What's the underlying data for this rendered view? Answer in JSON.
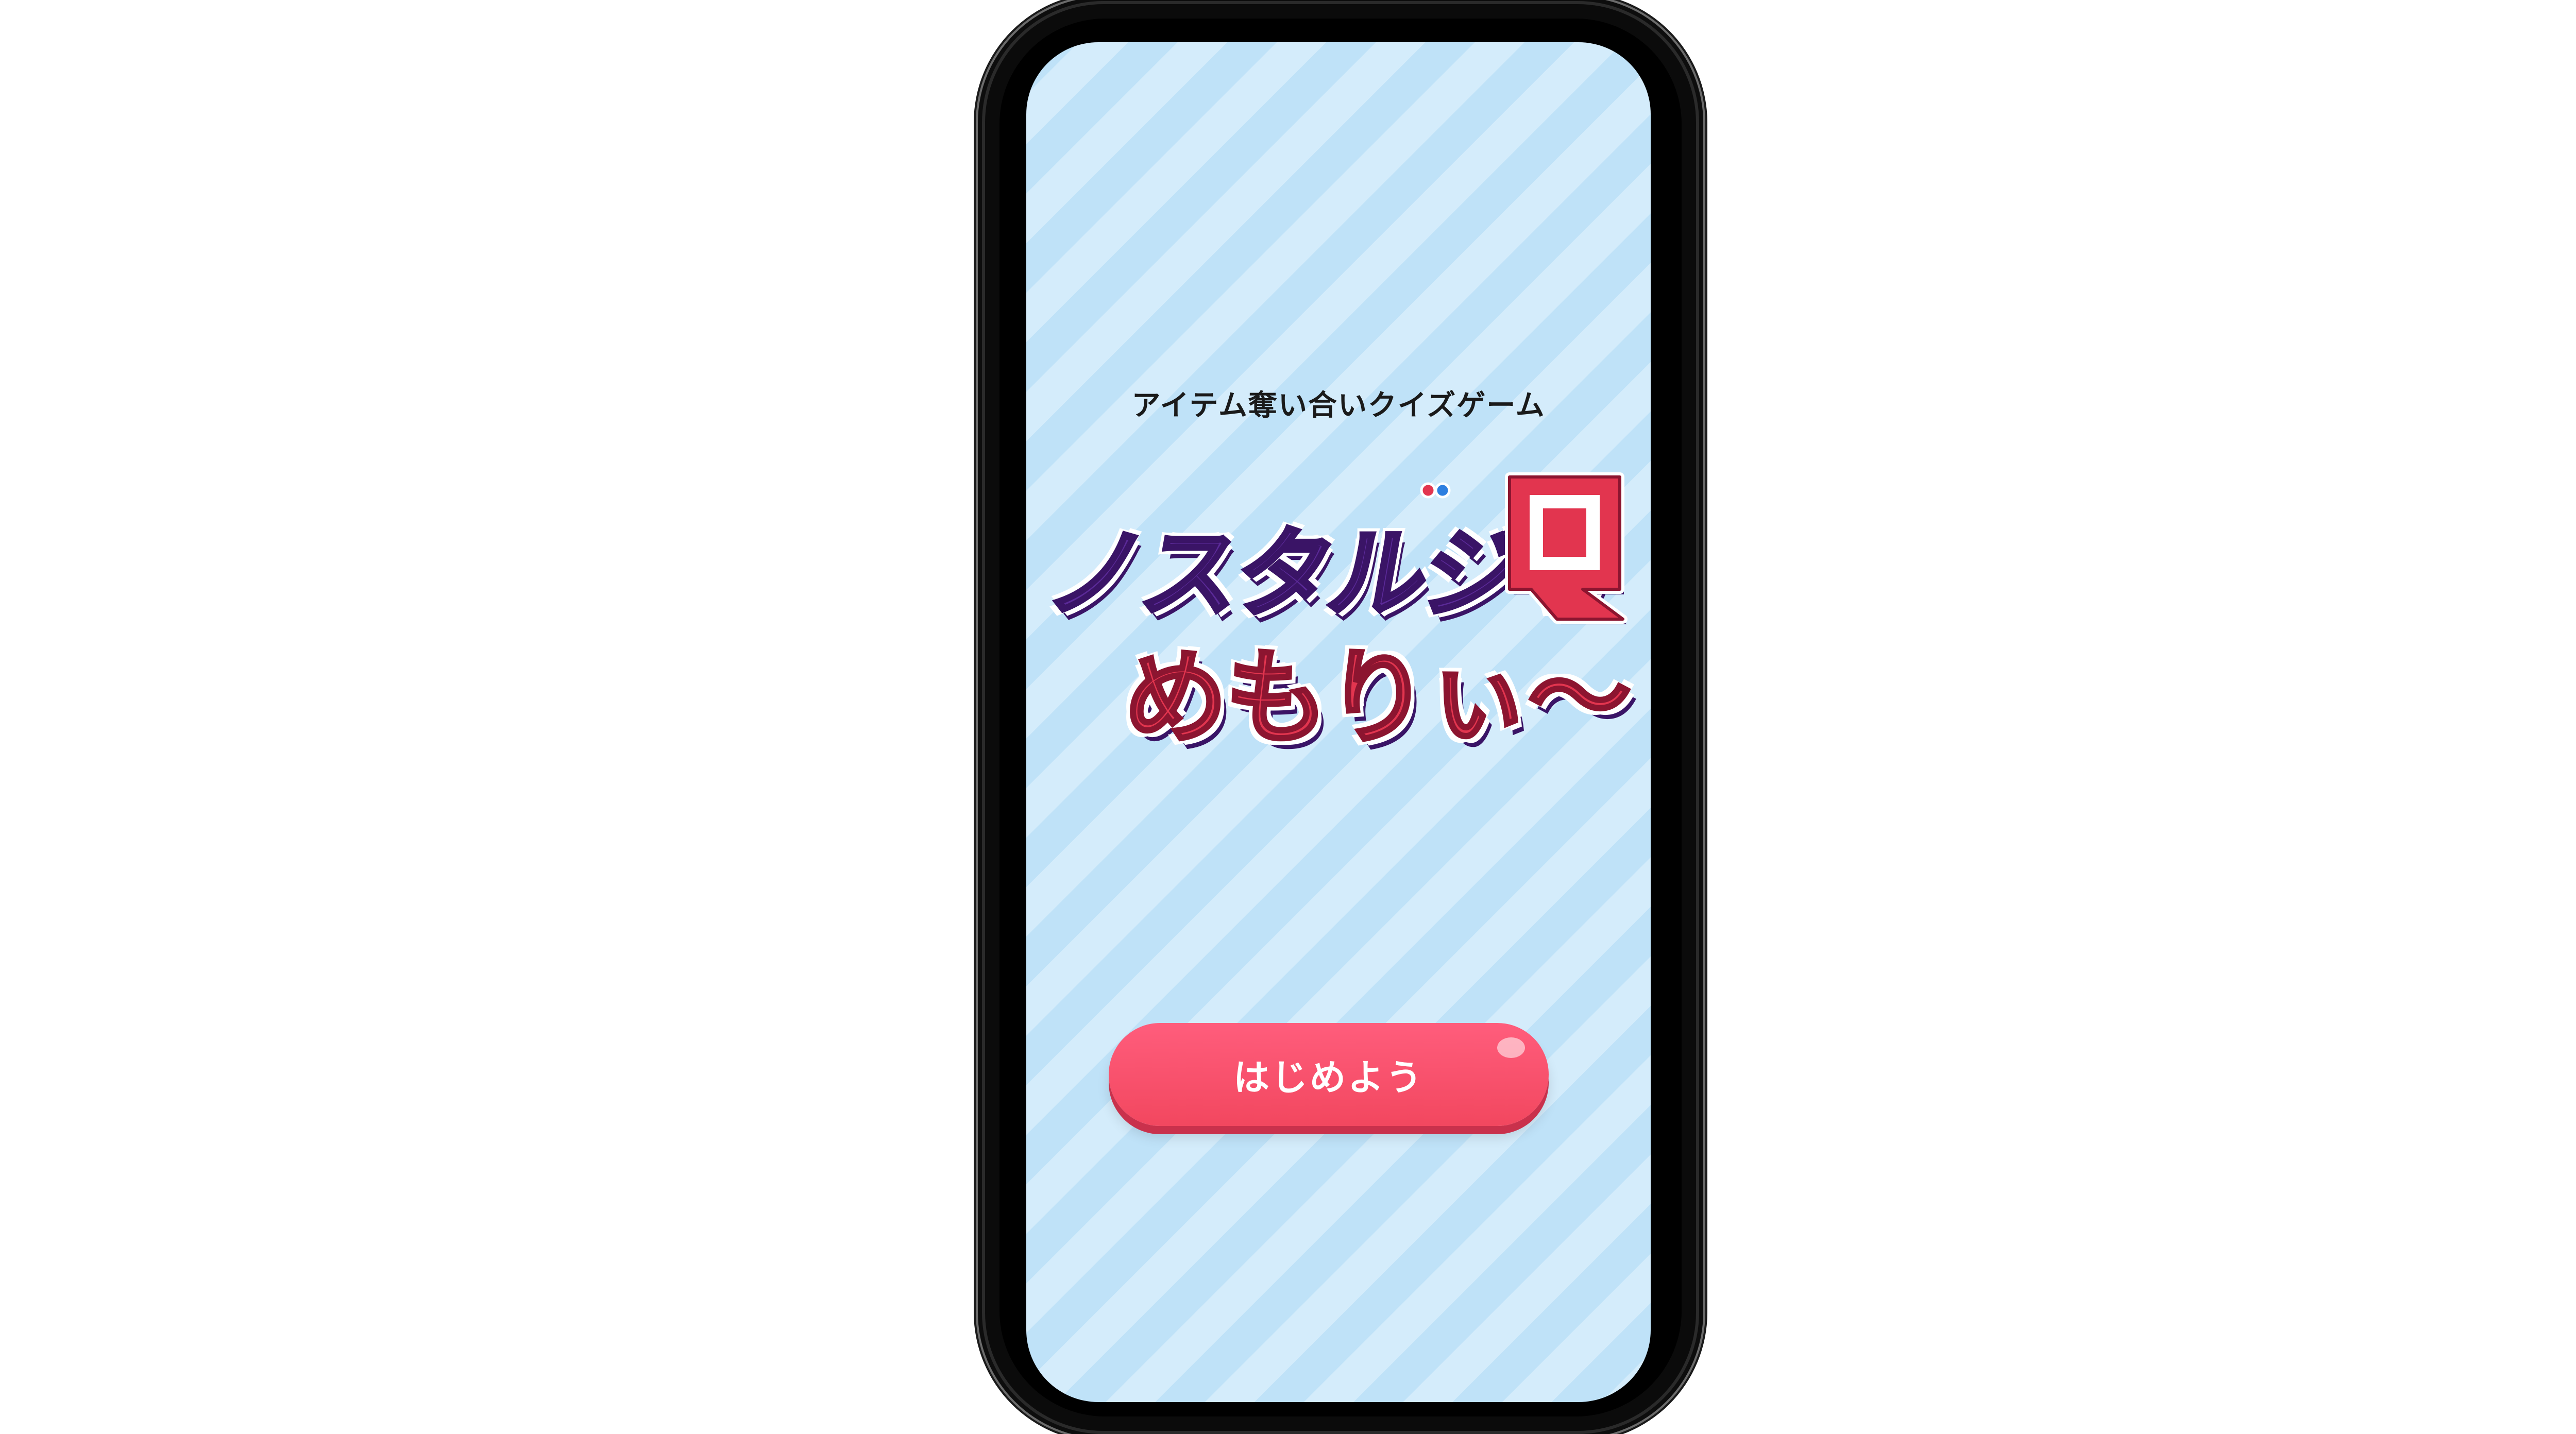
{
  "screen": {
    "subtitle": "アイテム奪い合いクイズゲーム",
    "logo": {
      "line1": "ノスタルジっ",
      "q_letter": "Q",
      "line2": "めもりぃ〜"
    },
    "start_button": {
      "label": "はじめよう"
    }
  },
  "colors": {
    "background_stripe_light": "#d4ecfb",
    "background_stripe_dark": "#bfe2f8",
    "logo_purple": "#5b2a98",
    "logo_red": "#e2354f",
    "button_pink": "#f2475f"
  }
}
